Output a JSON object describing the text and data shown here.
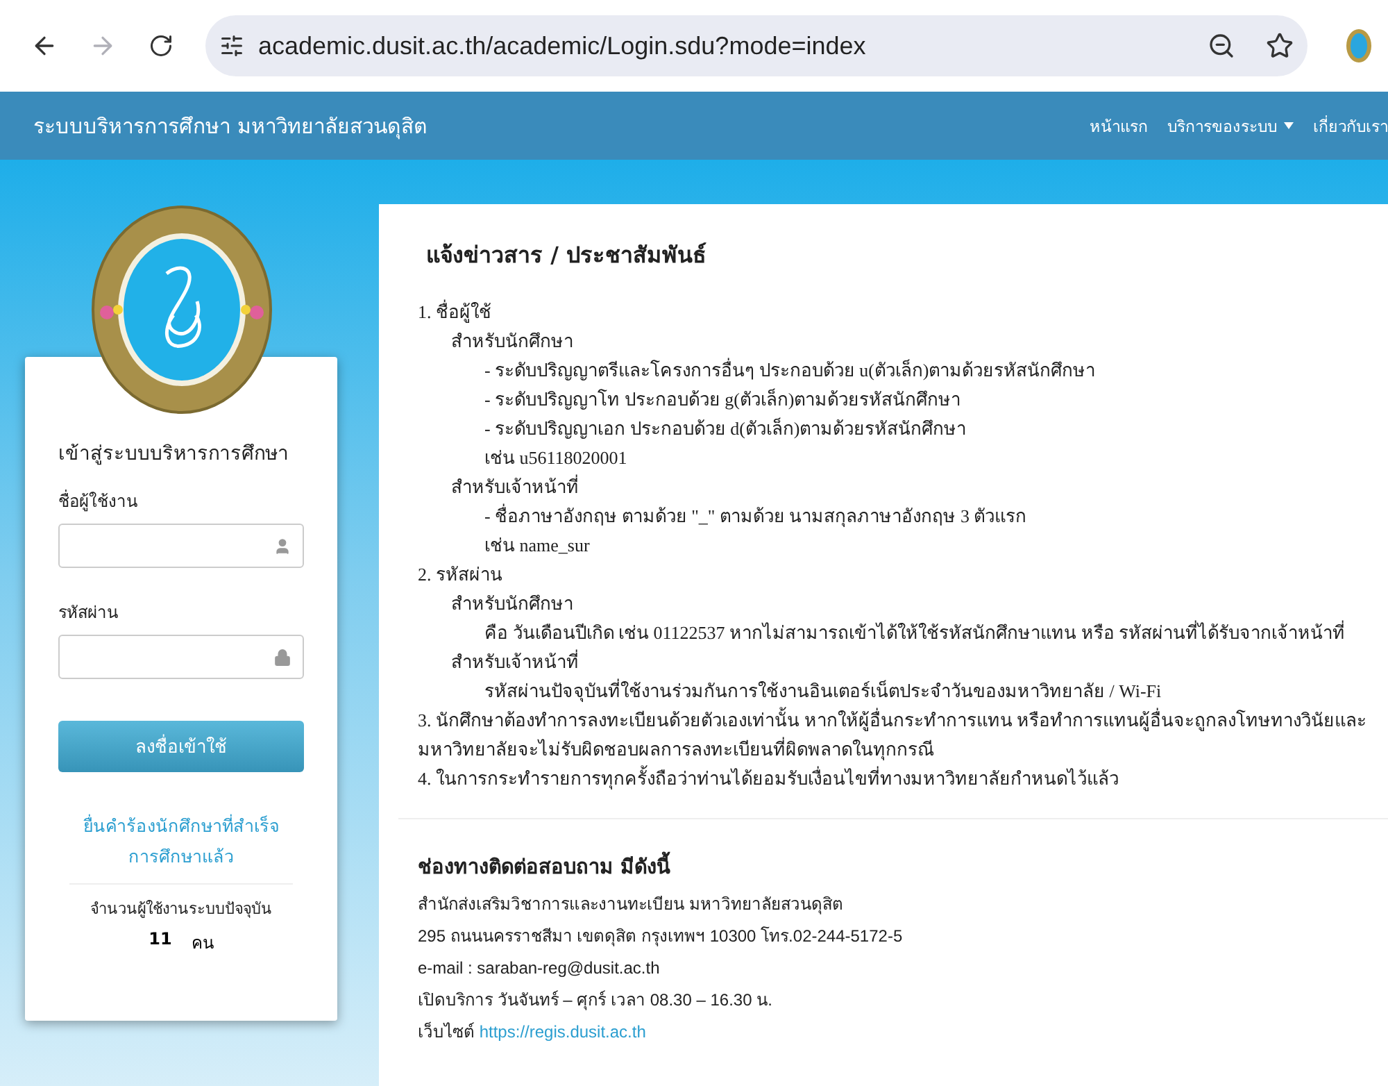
{
  "browser": {
    "back": {
      "disabled": false
    },
    "forward": {
      "disabled": true
    },
    "url": "academic.dusit.ac.th/academic/Login.sdu?mode=index"
  },
  "navbar": {
    "title": "ระบบบริหารการศึกษา มหาวิทยาลัยสวนดุสิต",
    "links": [
      {
        "label": "หน้าแรก",
        "dropdown": false
      },
      {
        "label": "บริการของระบบ",
        "dropdown": true
      },
      {
        "label": "เกี่ยวกับเรา",
        "dropdown": false
      }
    ]
  },
  "login": {
    "heading": "เข้าสู่ระบบบริหารการศึกษา",
    "fields": [
      {
        "label": "ชื่อผู้ใช้งาน",
        "kind": "user"
      },
      {
        "label": "รหัสผ่าน",
        "kind": "password"
      }
    ],
    "submit": "ลงชื่อเข้าใช้",
    "graduate_link": "ยื่นคำร้องนักศึกษาที่สำเร็จการศึกษาแล้ว",
    "users_label": "จำนวนผู้ใช้งานระบบปัจจุบัน",
    "users_count": "11",
    "users_unit": "คน"
  },
  "notice": {
    "title": "แจ้งข่าวสาร / ประชาสัมพันธ์",
    "items": [
      {
        "text": "1. ชื่อผู้ใช้",
        "children": [
          {
            "text": "สำหรับนักศึกษา",
            "children": [
              {
                "text": "- ระดับปริญญาตรีและโครงการอื่นๆ ประกอบด้วย u(ตัวเล็ก)ตามด้วยรหัสนักศึกษา"
              },
              {
                "text": "- ระดับปริญญาโท ประกอบด้วย g(ตัวเล็ก)ตามด้วยรหัสนักศึกษา"
              },
              {
                "text": "- ระดับปริญญาเอก ประกอบด้วย d(ตัวเล็ก)ตามด้วยรหัสนักศึกษา"
              },
              {
                "text": "เช่น u56118020001"
              }
            ]
          },
          {
            "text": "สำหรับเจ้าหน้าที่",
            "children": [
              {
                "text": "- ชื่อภาษาอังกฤษ ตามด้วย \"_\" ตามด้วย นามสกุลภาษาอังกฤษ 3 ตัวแรก"
              },
              {
                "text": "เช่น name_sur"
              }
            ]
          }
        ]
      },
      {
        "text": "2. รหัสผ่าน",
        "children": [
          {
            "text": "สำหรับนักศึกษา",
            "children": [
              {
                "text": "คือ วันเดือนปีเกิด เช่น 01122537 หากไม่สามารถเข้าได้ให้ใช้รหัสนักศึกษาแทน หรือ รหัสผ่านที่ได้รับจากเจ้าหน้าที่"
              }
            ]
          },
          {
            "text": "สำหรับเจ้าหน้าที่",
            "children": [
              {
                "text": "รหัสผ่านปัจจุบันที่ใช้งานร่วมกันการใช้งานอินเตอร์เน็ตประจำวันของมหาวิทยาลัย / Wi-Fi"
              }
            ]
          }
        ]
      },
      {
        "text": "3. นักศึกษาต้องทำการลงทะเบียนด้วยตัวเองเท่านั้น หากให้ผู้อื่นกระทำการแทน หรือทำการแทนผู้อื่นจะถูกลงโทษทางวินัยและมหาวิทยาลัยจะไม่รับผิดชอบผลการลงทะเบียนที่ผิดพลาดในทุกกรณี"
      },
      {
        "text": "4. ในการกระทำรายการทุกครั้งถือว่าท่านได้ยอมรับเงื่อนไขที่ทางมหาวิทยาลัยกำหนดไว้แล้ว"
      }
    ]
  },
  "contact": {
    "title": "ช่องทางติดต่อสอบถาม มีดังนี้",
    "lines": [
      "สำนักส่งเสริมวิชาการและงานทะเบียน มหาวิทยาลัยสวนดุสิต",
      "295 ถนนนครราชสีมา เขตดุสิต กรุงเทพฯ 10300  โทร.02-244-5172-5",
      "e-mail : saraban-reg@dusit.ac.th",
      "เปิดบริการ วันจันทร์ – ศุกร์ เวลา 08.30 – 16.30 น."
    ],
    "website_label": "เว็บไซต์",
    "website": "https://regis.dusit.ac.th"
  }
}
